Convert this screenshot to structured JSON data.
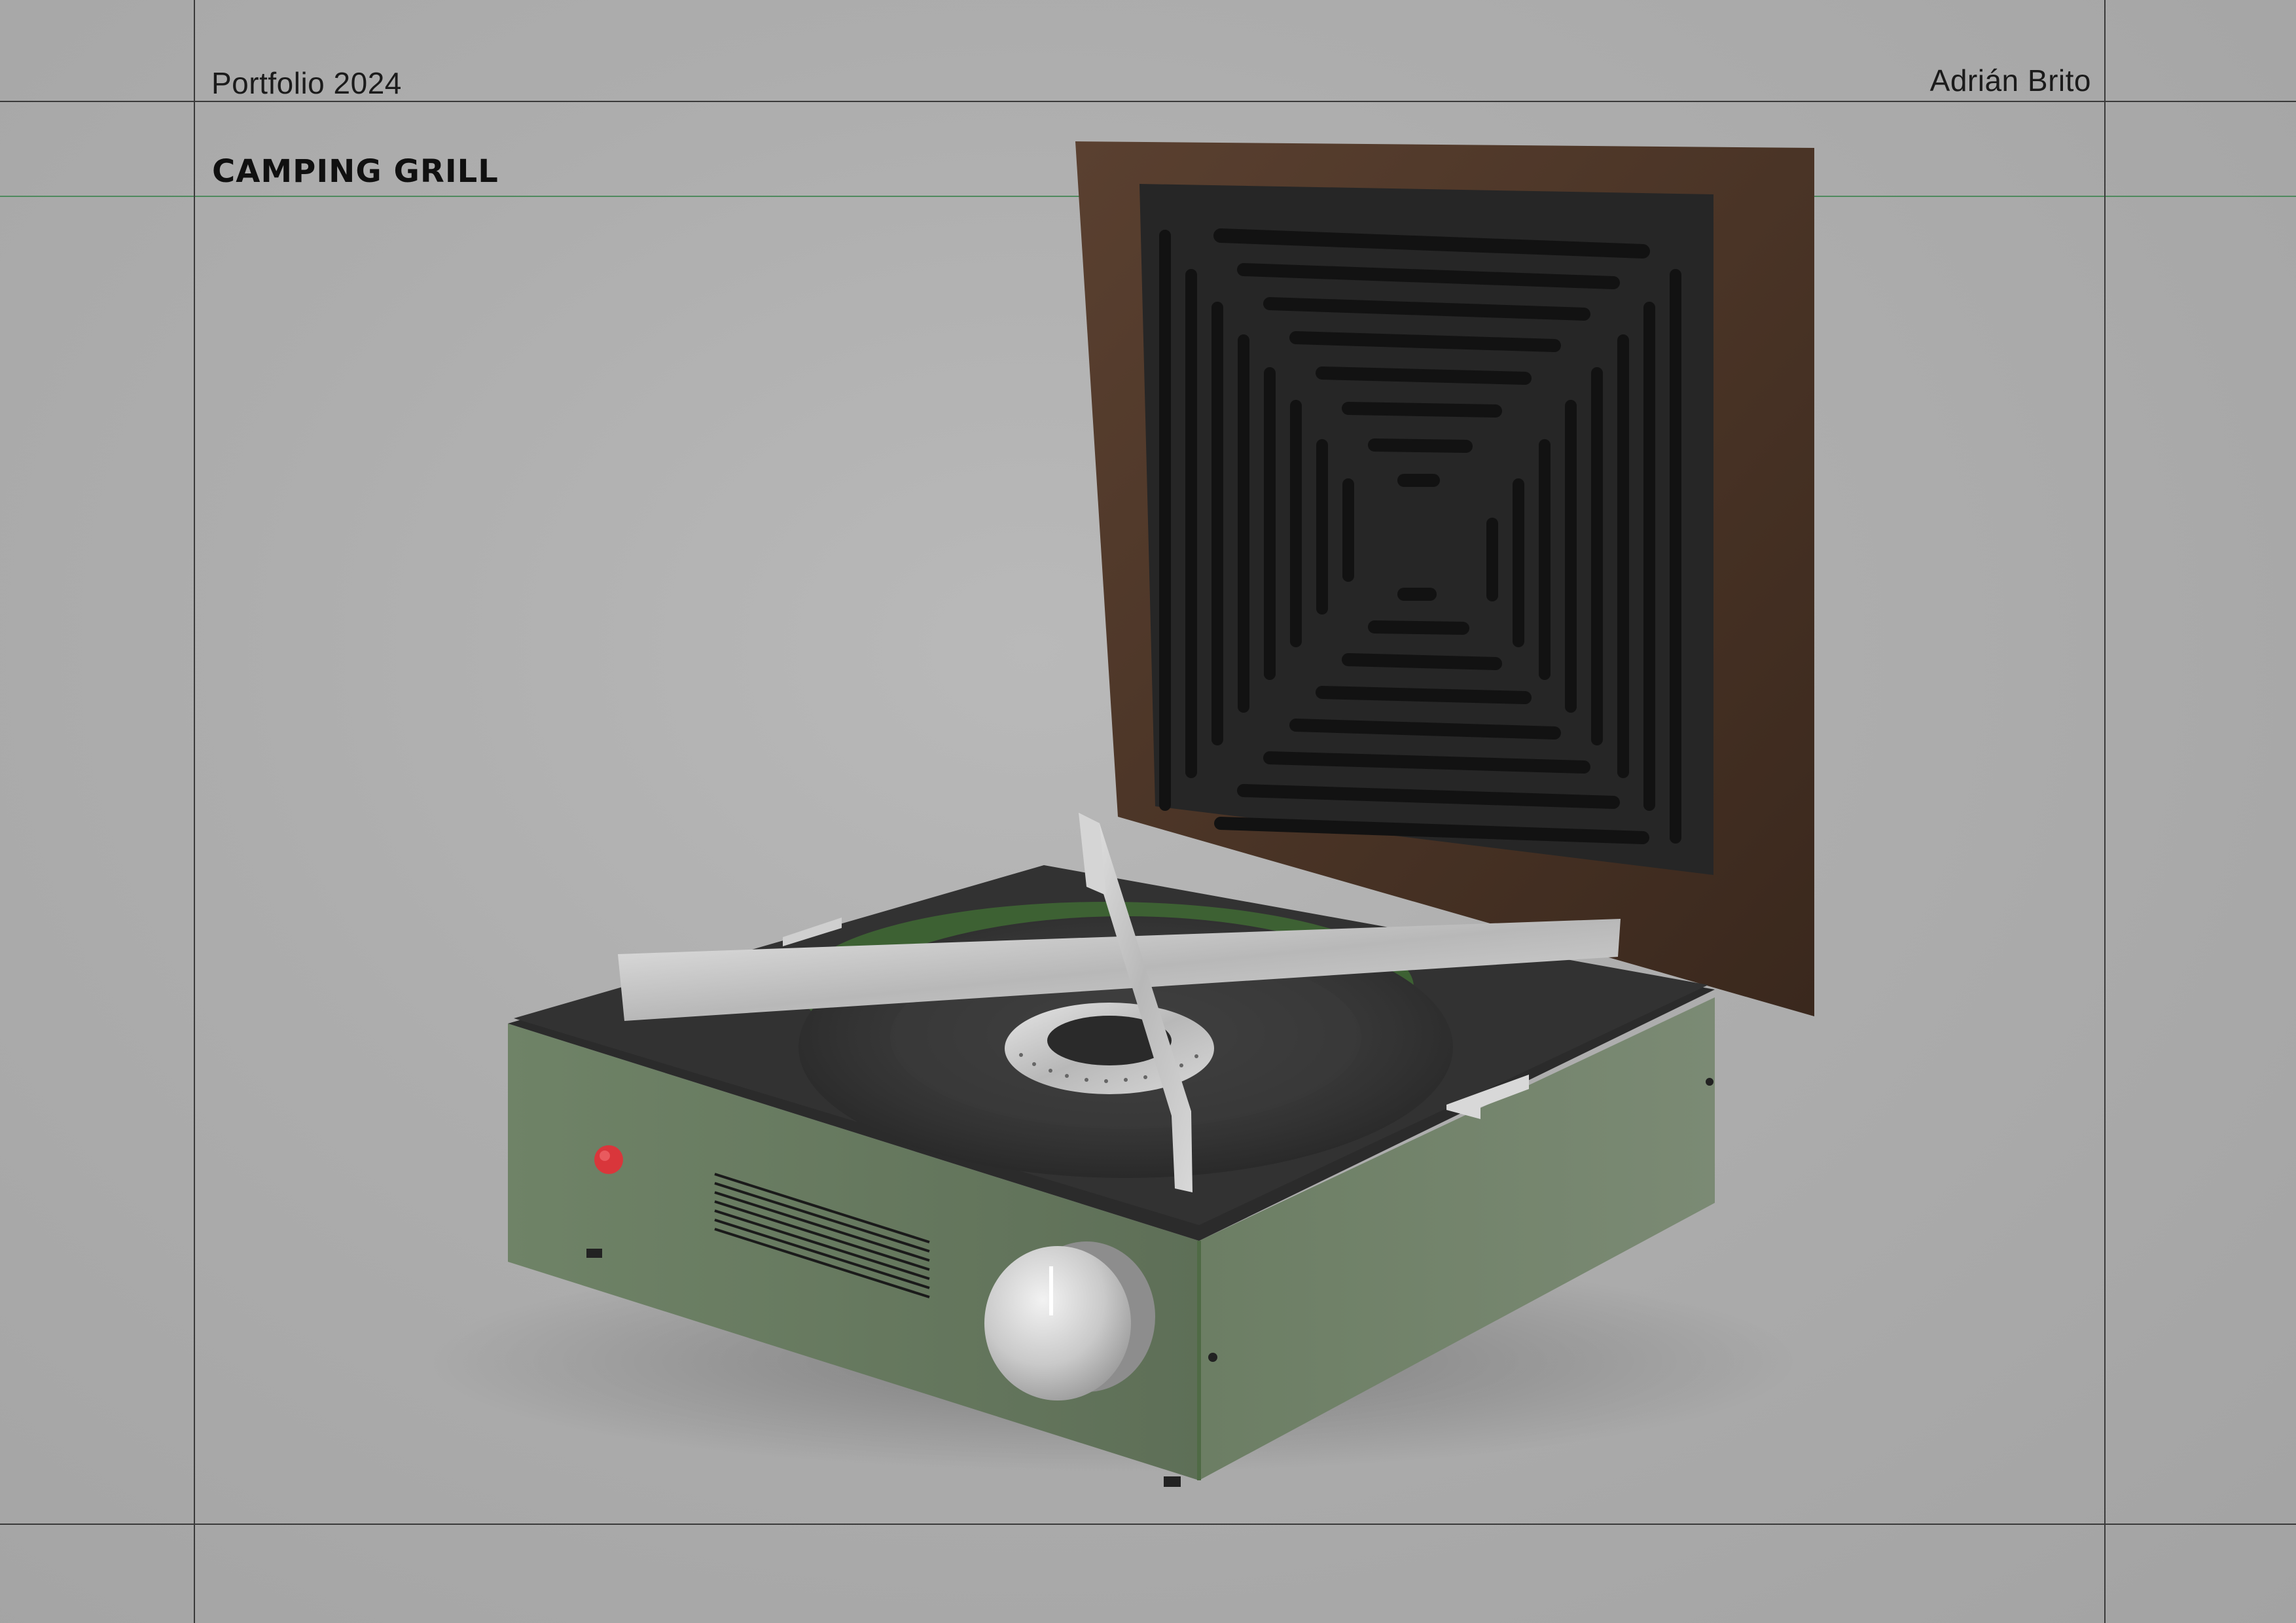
{
  "header": {
    "left_label": "Portfolio 2024",
    "right_label": "Adrián Brito"
  },
  "project": {
    "title": "CAMPING GRILL"
  },
  "colors": {
    "background": "#ababab",
    "guide_lines": "#3a3a3a",
    "accent_guide": "#4f8a5e",
    "body_green": "#6b7d63",
    "wood_lid": "#4a3426",
    "grill_black": "#232323",
    "ignition_button": "#d9363b",
    "steel": "#c8c8c8"
  }
}
